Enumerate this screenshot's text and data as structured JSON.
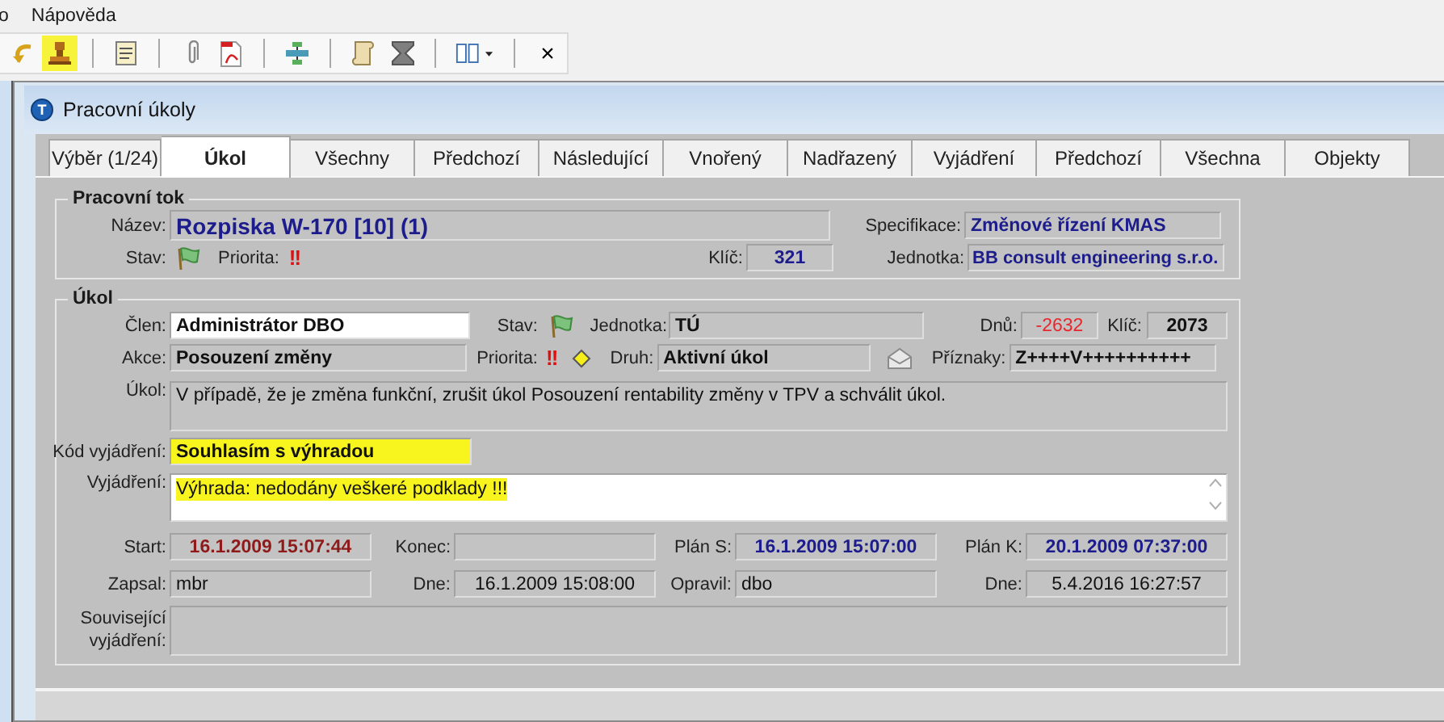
{
  "menu": [
    {
      "label": "o"
    },
    {
      "label": "Nápověda"
    }
  ],
  "toolbar": [
    [
      {
        "kind": "undo",
        "highlighted": false
      },
      {
        "kind": "stamp",
        "highlighted": true
      }
    ],
    [
      {
        "kind": "note",
        "highlighted": false
      }
    ],
    [
      {
        "kind": "clip",
        "highlighted": false
      },
      {
        "kind": "pdf",
        "highlighted": false
      }
    ],
    [
      {
        "kind": "flowchart",
        "highlighted": false
      }
    ],
    [
      {
        "kind": "scroll",
        "highlighted": false
      },
      {
        "kind": "hourglass",
        "highlighted": false
      }
    ],
    [
      {
        "kind": "columns",
        "highlighted": false
      }
    ],
    [
      {
        "kind": "close",
        "text": "×",
        "highlighted": false
      }
    ]
  ],
  "window": {
    "icon_text": "T",
    "title": "Pracovní úkoly"
  },
  "tabs": [
    {
      "label": "Výběr (1/24)",
      "selected": false
    },
    {
      "label": "Úkol",
      "selected": true
    },
    {
      "label": "Všechny",
      "selected": false
    },
    {
      "label": "Předchozí",
      "selected": false
    },
    {
      "label": "Následující",
      "selected": false
    },
    {
      "label": "Vnořený",
      "selected": false
    },
    {
      "label": "Nadřazený",
      "selected": false
    },
    {
      "label": "Vyjádření",
      "selected": false
    },
    {
      "label": "Předchozí",
      "selected": false
    },
    {
      "label": "Všechna",
      "selected": false
    },
    {
      "label": "Objekty",
      "selected": false
    }
  ],
  "workflow": {
    "title": "Pracovní tok",
    "name": {
      "label": "Název:",
      "value": "Rozpiska W-170 [10] (1)"
    },
    "specification": {
      "label": "Specifikace:",
      "value": "Změnové řízení KMAS"
    },
    "state": {
      "label": "Stav:"
    },
    "priority": {
      "label": "Priorita:",
      "value": "!!"
    },
    "key": {
      "label": "Klíč:",
      "value": "321"
    },
    "unit": {
      "label": "Jednotka:",
      "value": "BB consult engineering s.r.o."
    }
  },
  "task": {
    "title": "Úkol",
    "member": {
      "label": "Člen:",
      "value": "Administrátor DBO"
    },
    "state": {
      "label": "Stav:"
    },
    "unit": {
      "label": "Jednotka:",
      "value": "TÚ"
    },
    "days": {
      "label": "Dnů:",
      "value": "-2632"
    },
    "key": {
      "label": "Klíč:",
      "value": "2073"
    },
    "action": {
      "label": "Akce:",
      "value": "Posouzení změny"
    },
    "priority": {
      "label": "Priorita:",
      "value": "!!"
    },
    "type": {
      "label": "Druh:",
      "value": "Aktivní úkol"
    },
    "flags": {
      "label": "Příznaky:",
      "value": "Z++++V++++++++++"
    },
    "description": {
      "label": "Úkol:",
      "value": "V případě, že je změna funkční, zrušit úkol Posouzení rentability změny v TPV a schválit úkol."
    },
    "response_code": {
      "label": "Kód vyjádření:",
      "value": "Souhlasím s výhradou",
      "highlighted": true
    },
    "response": {
      "label": "Vyjádření:",
      "value": "Výhrada: nedodány veškeré podklady !!!",
      "highlighted": true
    },
    "start": {
      "label": "Start:",
      "value": "16.1.2009 15:07:44"
    },
    "end": {
      "label": "Konec:"
    },
    "plan_start": {
      "label": "Plán S:",
      "value": "16.1.2009 15:07:00"
    },
    "plan_end": {
      "label": "Plán K:",
      "value": "20.1.2009 07:37:00"
    },
    "written_by": {
      "label": "Zapsal:",
      "value": "mbr"
    },
    "written_on": {
      "label": "Dne:",
      "value": "16.1.2009 15:08:00"
    },
    "modified_by": {
      "label": "Opravil:",
      "value": "dbo"
    },
    "modified_on": {
      "label": "Dne:",
      "value": "5.4.2016 16:27:57"
    },
    "related": {
      "label": "Související vyjádření:"
    }
  }
}
